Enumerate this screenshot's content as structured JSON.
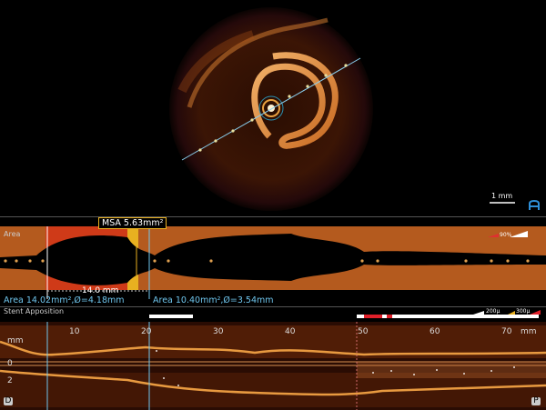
{
  "cross_section": {
    "scale_bar_label": "1 mm",
    "logo_text": "Abbott"
  },
  "area_panel": {
    "title": "Area",
    "msa_label": "MSA 5.63mm²",
    "length_label": "14.0 mm",
    "proximal_ref": "Area 14.02mm²,Ø=4.18mm",
    "distal_ref": "Area 10.40mm²,Ø=3.54mm",
    "legend_percent": "90%"
  },
  "stent_apposition": {
    "title": "Stent Apposition",
    "legend": [
      "200µ",
      "300µ"
    ]
  },
  "longitudinal": {
    "unit_label": "mm",
    "y_ticks": [
      "mm",
      "0",
      "2"
    ],
    "x_ticks": [
      "10",
      "20",
      "30",
      "40",
      "50",
      "60",
      "70"
    ],
    "x_unit": "mm",
    "distal_badge": "D",
    "proximal_badge": "P"
  },
  "colors": {
    "accent_blue": "#6fc6ee",
    "msa_yellow": "#e8b020",
    "tissue_orange": "#c4621c",
    "malapposition_red": "#e0202a"
  }
}
